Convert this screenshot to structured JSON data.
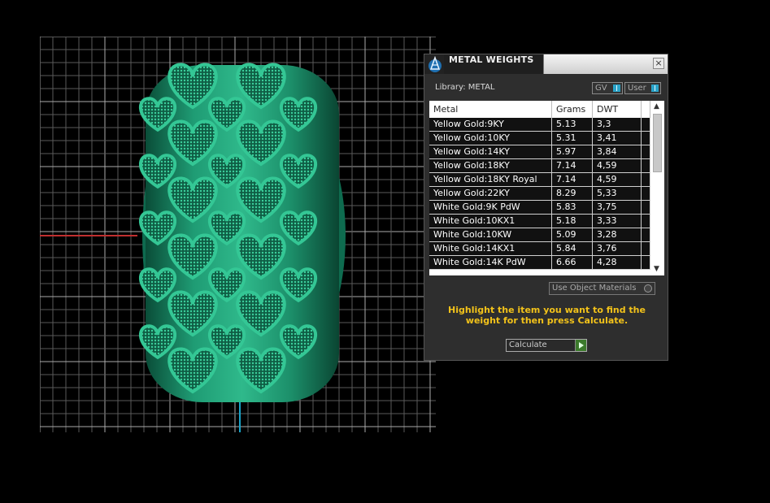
{
  "dialog": {
    "title": "METAL WEIGHTS",
    "close_glyph": "×",
    "library_label": "Library: METAL",
    "toggle_gv": "GV",
    "toggle_user": "User",
    "use_object_materials": "Use Object Materials",
    "hint": "Highlight the item you want to find the weight for then press Calculate.",
    "calculate_label": "Calculate"
  },
  "table": {
    "columns": [
      "Metal",
      "Grams",
      "DWT"
    ],
    "rows": [
      [
        "Yellow Gold:9KY",
        "5.13",
        "3,3"
      ],
      [
        "Yellow Gold:10KY",
        "5.31",
        "3,41"
      ],
      [
        "Yellow Gold:14KY",
        "5.97",
        "3,84"
      ],
      [
        "Yellow Gold:18KY",
        "7.14",
        "4,59"
      ],
      [
        "Yellow Gold:18KY Royal",
        "7.14",
        "4,59"
      ],
      [
        "Yellow Gold:22KY",
        "8.29",
        "5,33"
      ],
      [
        "White Gold:9K PdW",
        "5.83",
        "3,75"
      ],
      [
        "White Gold:10KX1",
        "5.18",
        "3,33"
      ],
      [
        "White Gold:10KW",
        "5.09",
        "3,28"
      ],
      [
        "White Gold:14KX1",
        "5.84",
        "3,76"
      ],
      [
        "White Gold:14K PdW",
        "6.66",
        "4,28"
      ]
    ]
  },
  "icons": {
    "app": "app-logo-icon",
    "close": "close-icon",
    "scroll_up": "scroll-up-icon",
    "scroll_down": "scroll-down-icon",
    "calculate": "play-arrow-icon"
  },
  "colors": {
    "ring": "#1e9a72",
    "grid": "#8a8a8a",
    "hint": "#f2c21a",
    "axis_x": "#c03030",
    "axis_y": "#1aa3c8"
  }
}
